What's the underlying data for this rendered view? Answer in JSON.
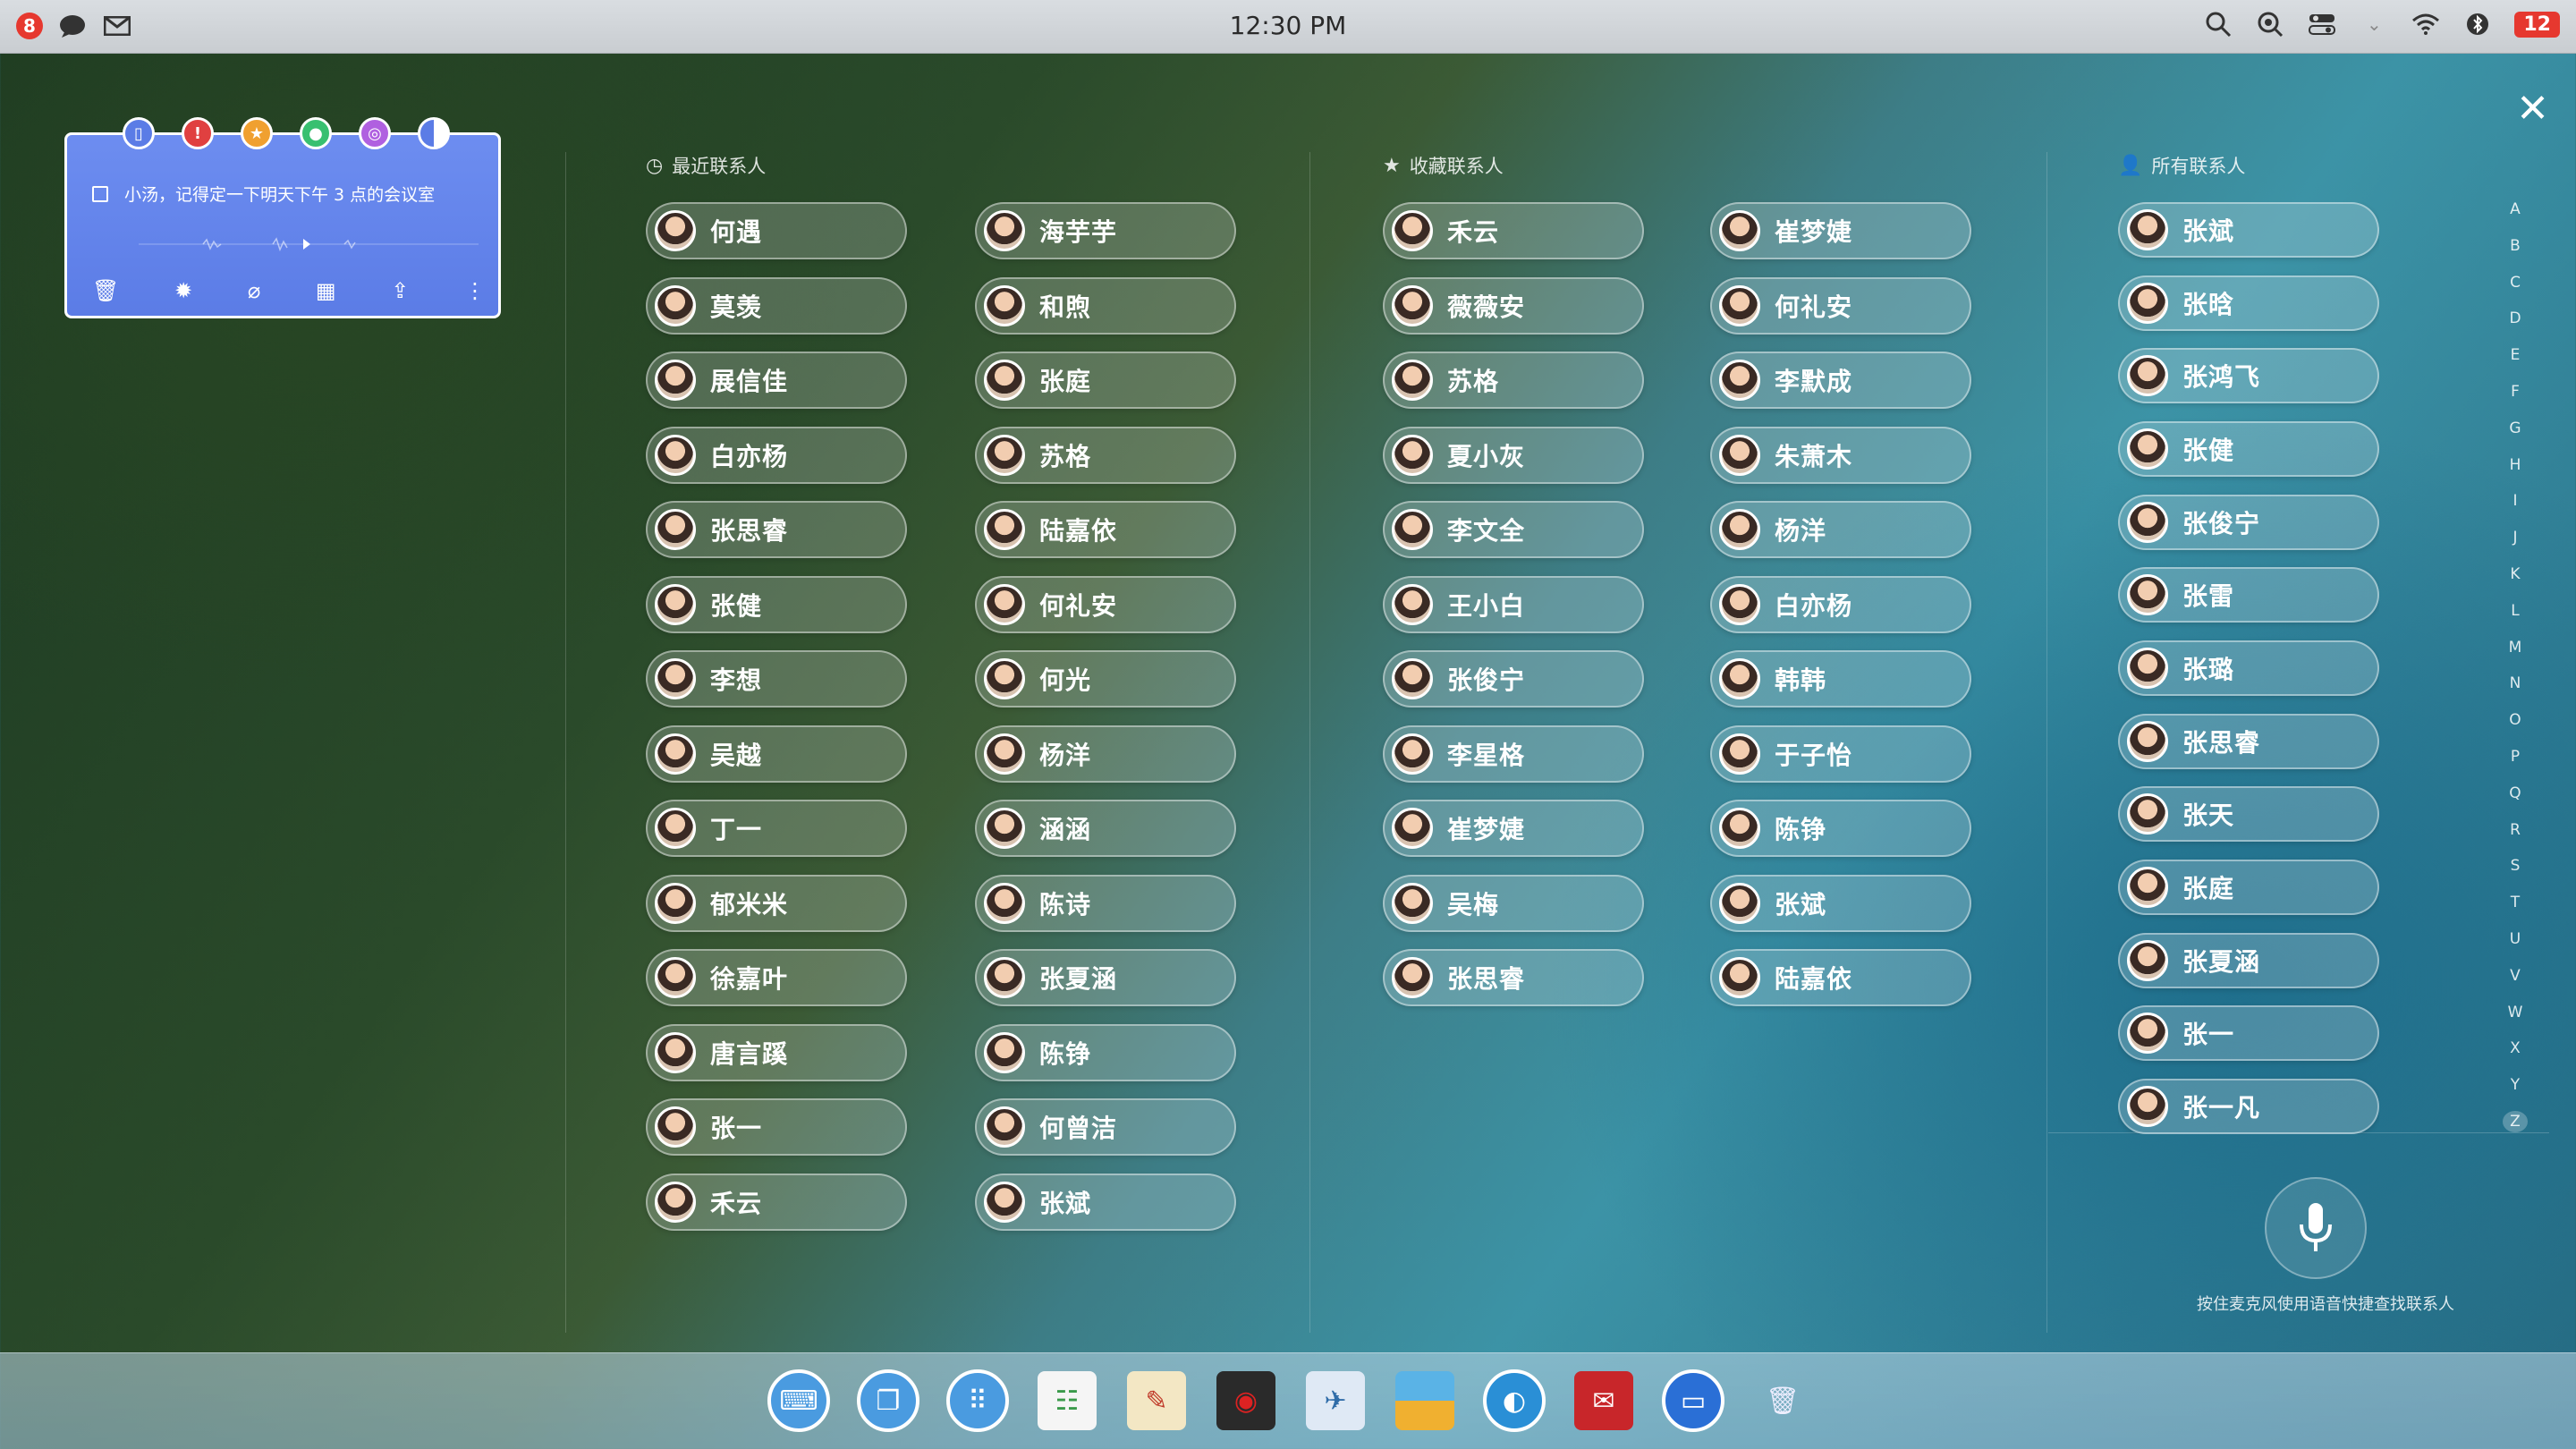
{
  "menubar": {
    "badge_count": "8",
    "clock": "12:30 PM",
    "notif_count": "12",
    "icons": [
      "chat-bubble-icon",
      "mail-icon",
      "search-icon",
      "spotlight-icon",
      "control-center-icon",
      "chevron-down-icon",
      "wifi-icon",
      "bluetooth-icon"
    ]
  },
  "note": {
    "text": "小汤，记得定一下明天下午 3 点的会议室",
    "tag_colors": [
      "#5b7ce6",
      "#e04040",
      "#f0a030",
      "#38c070",
      "#b060e0",
      "#ffffff"
    ],
    "tools": [
      "delete-icon",
      "brightness-icon",
      "attach-icon",
      "calendar-icon",
      "share-icon",
      "more-icon"
    ]
  },
  "sections": {
    "recent": "最近联系人",
    "favorites": "收藏联系人",
    "all": "所有联系人"
  },
  "recent_col1": [
    "何遇",
    "莫羡",
    "展信佳",
    "白亦杨",
    "张思睿",
    "张健",
    "李想",
    "吴越",
    "丁一",
    "郁米米",
    "徐嘉叶",
    "唐言蹊",
    "张一",
    "禾云"
  ],
  "recent_col2": [
    "海芋芋",
    "和煦",
    "张庭",
    "苏格",
    "陆嘉依",
    "何礼安",
    "何光",
    "杨洋",
    "涵涵",
    "陈诗",
    "张夏涵",
    "陈铮",
    "何曾洁",
    "张斌"
  ],
  "fav_col1": [
    "禾云",
    "薇薇安",
    "苏格",
    "夏小灰",
    "李文全",
    "王小白",
    "张俊宁",
    "李星格",
    "崔梦婕",
    "吴梅",
    "张思睿"
  ],
  "fav_col2": [
    "崔梦婕",
    "何礼安",
    "李默成",
    "朱萧木",
    "杨洋",
    "白亦杨",
    "韩韩",
    "于子怡",
    "陈铮",
    "张斌",
    "陆嘉依"
  ],
  "all_col": [
    "张斌",
    "张晗",
    "张鸿飞",
    "张健",
    "张俊宁",
    "张雷",
    "张璐",
    "张思睿",
    "张天",
    "张庭",
    "张夏涵",
    "张一",
    "张一凡"
  ],
  "alphabet": [
    "A",
    "B",
    "C",
    "D",
    "E",
    "F",
    "G",
    "H",
    "I",
    "J",
    "K",
    "L",
    "M",
    "N",
    "O",
    "P",
    "Q",
    "R",
    "S",
    "T",
    "U",
    "V",
    "W",
    "X",
    "Y",
    "Z"
  ],
  "alphabet_selected": "Z",
  "mic_hint": "按住麦克风使用语音快捷查找联系人",
  "dock": [
    "keyboard-icon",
    "windows-icon",
    "launcher-icon",
    "contacts-icon",
    "notes-icon",
    "music-icon",
    "photos-icon",
    "gallery-icon",
    "browser-icon",
    "mail-app-icon",
    "messages-icon",
    "trash-icon"
  ]
}
